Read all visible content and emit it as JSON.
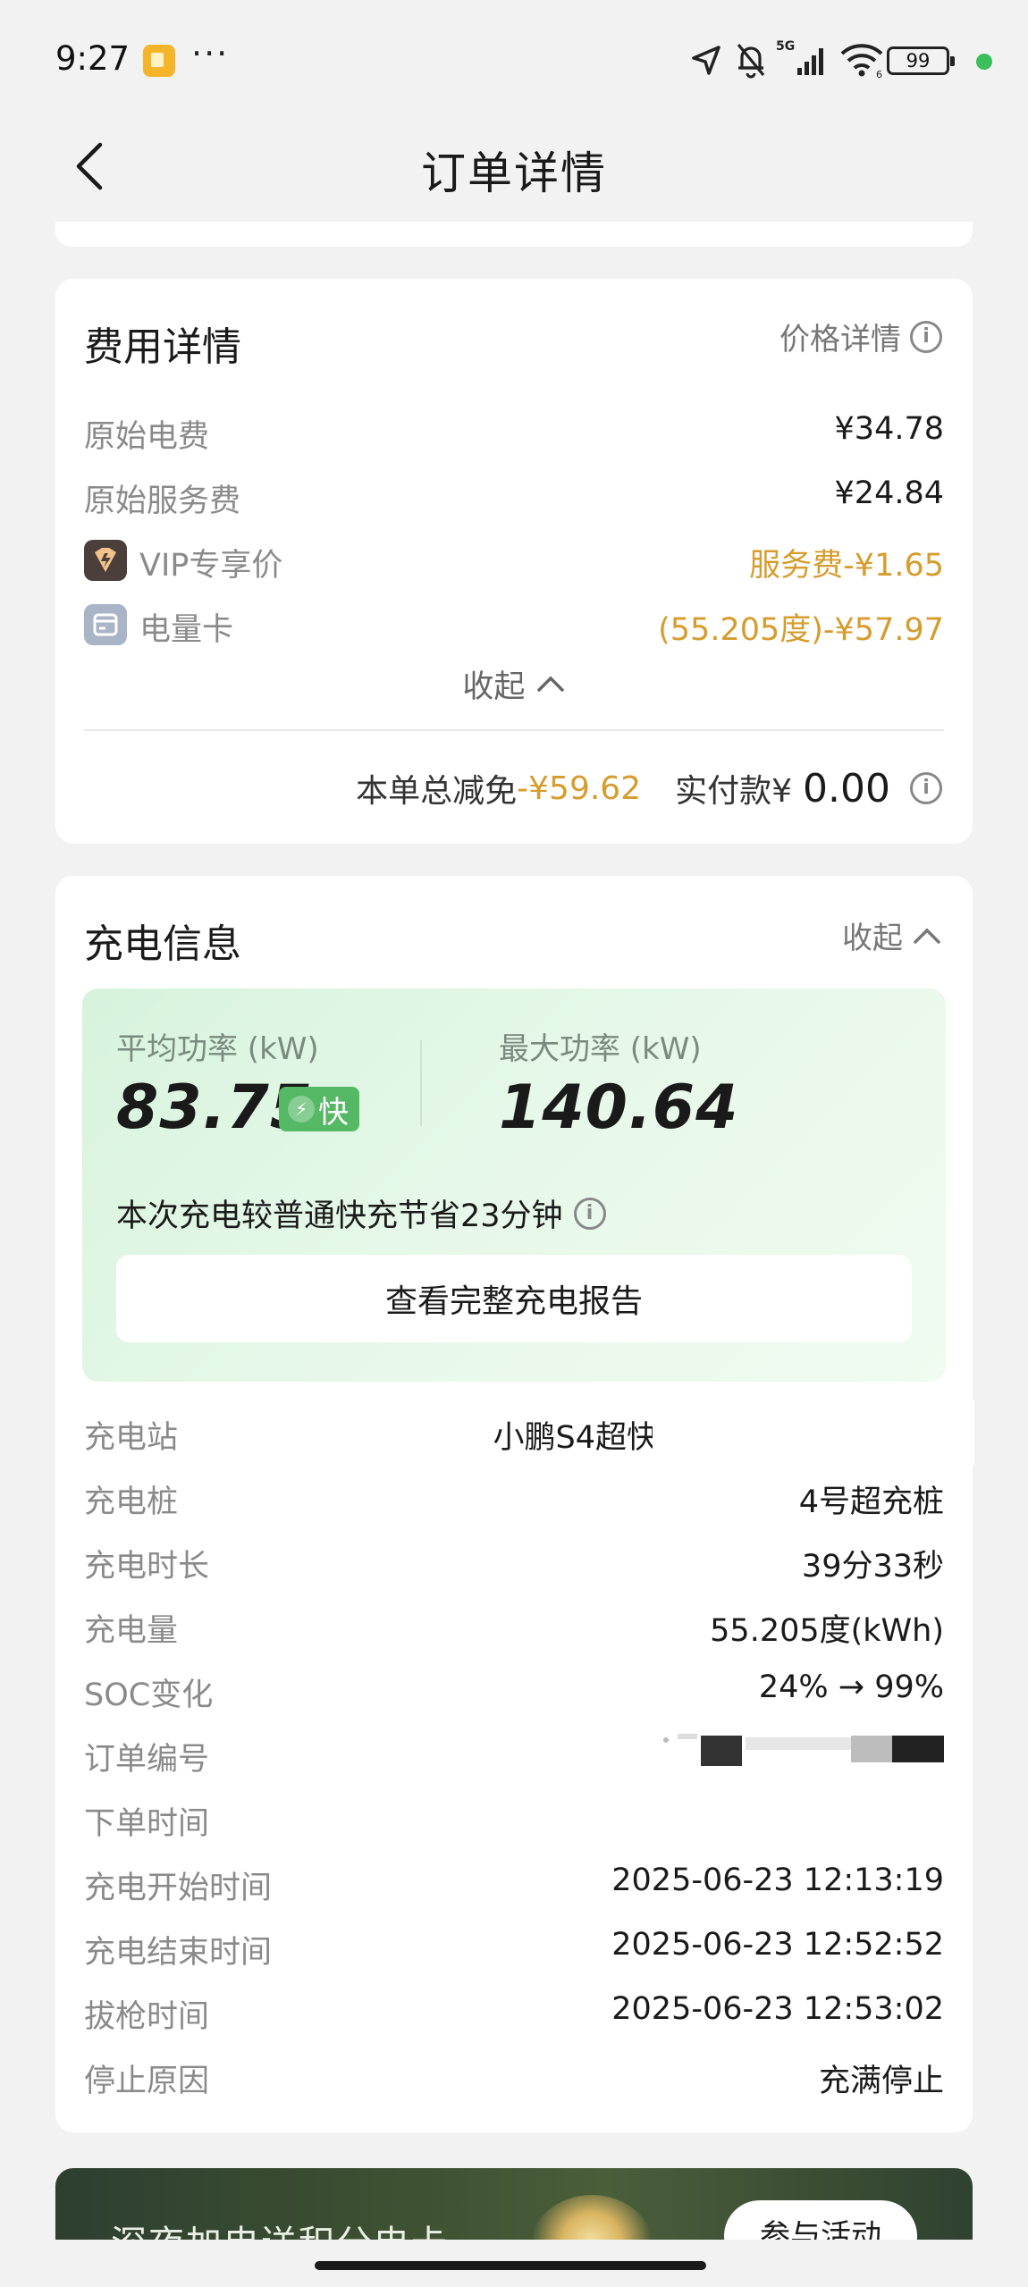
{
  "status_bar": {
    "time": "9:27",
    "dots": "···",
    "battery": "99",
    "network": "5G"
  },
  "header": {
    "title": "订单详情"
  },
  "fee_card": {
    "title": "费用详情",
    "price_detail_link": "价格详情",
    "rows": [
      {
        "label": "原始电费",
        "value": "¥34.78"
      },
      {
        "label": "原始服务费",
        "value": "¥24.84"
      },
      {
        "label": "VIP专享价",
        "value": "服务费-¥1.65"
      },
      {
        "label": "电量卡",
        "value": "(55.205度)-¥57.97"
      }
    ],
    "collapse_label": "收起",
    "total_discount_label": "本单总减免",
    "total_discount_value": "-¥59.62",
    "paid_label": "实付款¥",
    "paid_value": "0.00"
  },
  "charge_card": {
    "title": "充电信息",
    "collapse_label": "收起",
    "avg_power_label": "平均功率 (kW)",
    "avg_power_value": "83.75",
    "fast_badge": "快",
    "max_power_label": "最大功率 (kW)",
    "max_power_value": "140.64",
    "saving_text": "本次充电较普通快充节省23分钟",
    "report_button": "查看完整充电报告",
    "rows": [
      {
        "label": "充电站",
        "value": "小鹏S4超快"
      },
      {
        "label": "充电桩",
        "value": "4号超充桩"
      },
      {
        "label": "充电时长",
        "value": "39分33秒"
      },
      {
        "label": "充电量",
        "value": "55.205度(kWh)"
      },
      {
        "label": "SOC变化",
        "value": "24% → 99%"
      },
      {
        "label": "订单编号",
        "value": ""
      },
      {
        "label": "下单时间",
        "value": ""
      },
      {
        "label": "充电开始时间",
        "value": "2025-06-23 12:13:19"
      },
      {
        "label": "充电结束时间",
        "value": "2025-06-23 12:52:52"
      },
      {
        "label": "拔枪时间",
        "value": "2025-06-23 12:53:02"
      },
      {
        "label": "停止原因",
        "value": "充满停止"
      }
    ]
  },
  "banner": {
    "text": "深夜加电送积分电卡",
    "button": "参与活动"
  },
  "colors": {
    "accent_gold": "#d69c2e",
    "fast_green": "#55b865",
    "power_box_bg": "#e6f8e9"
  }
}
